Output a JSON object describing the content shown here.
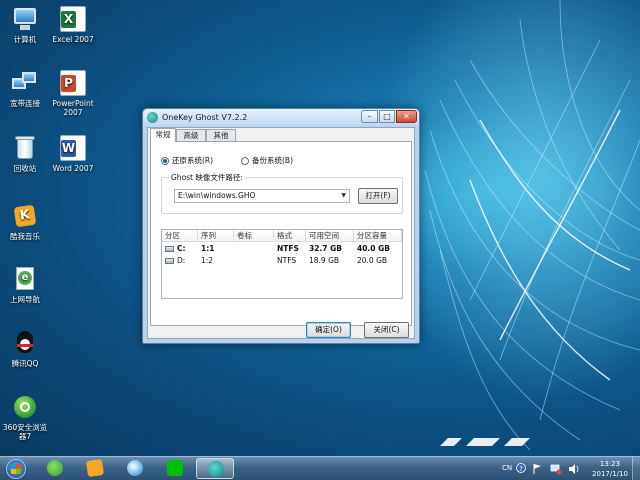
{
  "desktop": {
    "icons": [
      {
        "label": "计算机"
      },
      {
        "label": "Excel 2007",
        "glyph": "X"
      },
      {
        "label": "宽带连接"
      },
      {
        "label": "PowerPoint 2007",
        "glyph": "P"
      },
      {
        "label": "回收站"
      },
      {
        "label": "Word 2007",
        "glyph": "W"
      },
      {
        "label": "酷我音乐",
        "glyph": "K"
      },
      {
        "label": "上网导航",
        "glyph": "e"
      },
      {
        "label": "腾讯QQ"
      },
      {
        "label": "360安全浏览器7"
      }
    ]
  },
  "window": {
    "title": "OneKey Ghost V7.2.2",
    "controls": {
      "minimize": "–",
      "maximize": "□",
      "close": "✕"
    },
    "tabs": [
      {
        "label": "常规"
      },
      {
        "label": "高级"
      },
      {
        "label": "其他"
      }
    ],
    "restore_label": "还原系统(R)",
    "backup_label": "备份系统(B)",
    "selected_mode": "restore",
    "ghost_group_label": "Ghost 映像文件路径:",
    "path_value": "E:\\win\\windows.GHO",
    "open_label": "打开(F)",
    "table": {
      "columns": [
        "分区",
        "序列",
        "卷标",
        "格式",
        "可用空间",
        "分区容量"
      ],
      "rows": [
        {
          "drive": "C:",
          "seq": "1:1",
          "label": "",
          "format": "NTFS",
          "free": "32.7 GB",
          "size": "40.0 GB",
          "selected": true
        },
        {
          "drive": "D:",
          "seq": "1:2",
          "label": "",
          "format": "NTFS",
          "free": "18.9 GB",
          "size": "20.0 GB",
          "selected": false
        }
      ]
    },
    "ok_label": "确定(O)",
    "cancel_label": "关闭(C)"
  },
  "taskbar": {
    "pinned": [
      {
        "name": "360-browser"
      },
      {
        "name": "kugou"
      },
      {
        "name": "browser"
      },
      {
        "name": "iqiyi"
      },
      {
        "name": "onekey-ghost",
        "active": true
      }
    ],
    "tray": {
      "lang": "CN"
    },
    "clock": {
      "time": "13:23",
      "date": "2017/1/10"
    }
  }
}
